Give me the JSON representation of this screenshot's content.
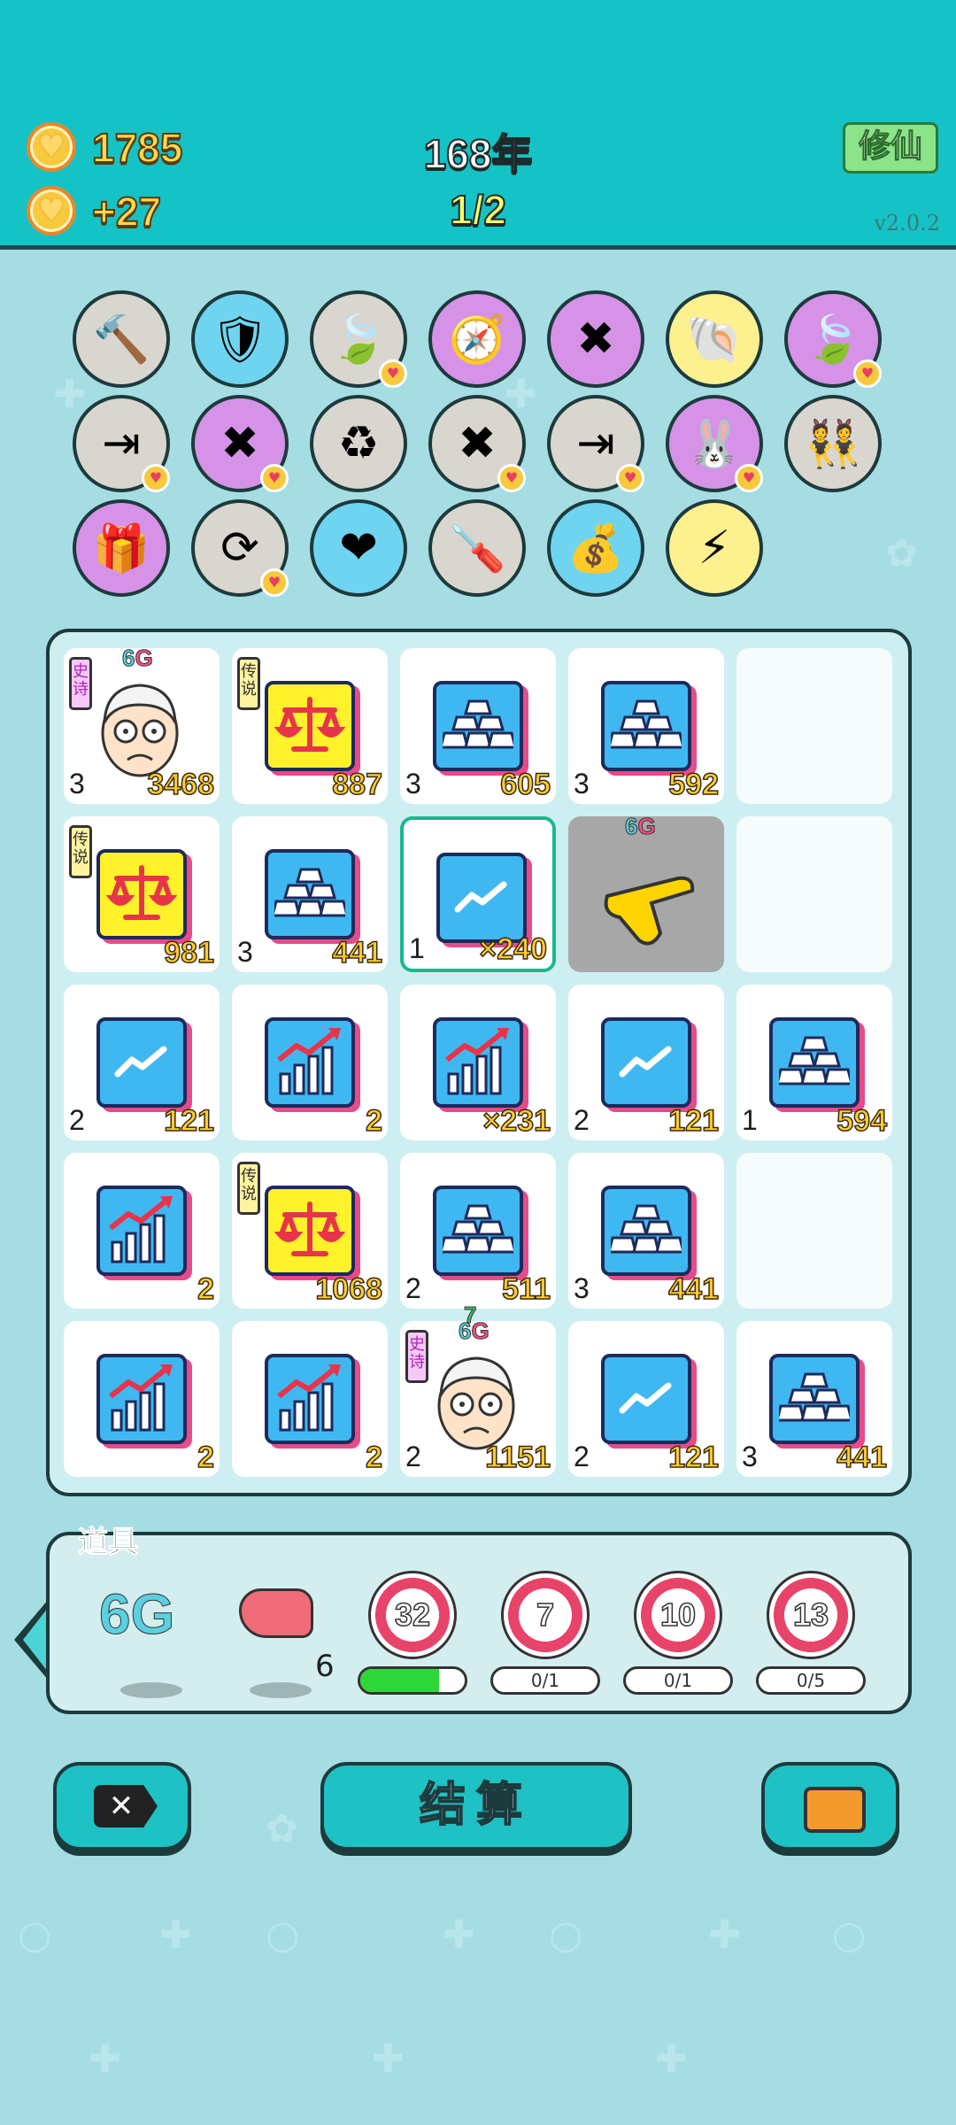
{
  "header": {
    "coins": "1785",
    "income": "+27",
    "year": "168年",
    "progress": "1/2",
    "cultivate_label": "修仙",
    "version": "v2.0.2"
  },
  "skills": [
    {
      "name": "hammer-icon",
      "glyph": "🔨",
      "bg": "gray",
      "badge": false
    },
    {
      "name": "shield-wrench-icon",
      "glyph": "🛡",
      "bg": "blue",
      "badge": false
    },
    {
      "name": "leaf-icon",
      "glyph": "🍃",
      "bg": "gray",
      "badge": true
    },
    {
      "name": "compass-icon",
      "glyph": "🧭",
      "bg": "purple",
      "badge": false
    },
    {
      "name": "multiplier-face-icon",
      "glyph": "✖",
      "bg": "purple",
      "badge": false
    },
    {
      "name": "shell-icon",
      "glyph": "🐚",
      "bg": "yellow",
      "badge": false
    },
    {
      "name": "leaf-icon",
      "glyph": "🍃",
      "bg": "purple",
      "badge": true
    },
    {
      "name": "skip-icon",
      "glyph": "⇥",
      "bg": "gray",
      "badge": true
    },
    {
      "name": "multiplier-face-icon",
      "glyph": "✖",
      "bg": "purple",
      "badge": true
    },
    {
      "name": "recycle-icon",
      "glyph": "♻",
      "bg": "gray",
      "badge": false
    },
    {
      "name": "delete-tag-icon",
      "glyph": "✖",
      "bg": "gray",
      "badge": true
    },
    {
      "name": "skip-icon",
      "glyph": "⇥",
      "bg": "gray",
      "badge": true
    },
    {
      "name": "rabbit-icon",
      "glyph": "🐰",
      "bg": "purple",
      "badge": true
    },
    {
      "name": "twins-icon",
      "glyph": "👯",
      "bg": "gray",
      "badge": false
    },
    {
      "name": "gift-box-icon",
      "glyph": "🎁",
      "bg": "purple",
      "badge": false
    },
    {
      "name": "refresh-icon",
      "glyph": "⟳",
      "bg": "gray",
      "badge": true
    },
    {
      "name": "heart-potion-icon",
      "glyph": "❤",
      "bg": "blue",
      "badge": false
    },
    {
      "name": "screwdriver-icon",
      "glyph": "🪛",
      "bg": "gray",
      "badge": false
    },
    {
      "name": "money-bag-icon",
      "glyph": "💰",
      "bg": "blue",
      "badge": false
    },
    {
      "name": "lightning-icon",
      "glyph": "⚡",
      "bg": "yellow",
      "badge": false
    }
  ],
  "board": [
    {
      "type": "face",
      "tag": "史诗",
      "tagType": "epic",
      "g": "6G",
      "level": "3",
      "value": "3468"
    },
    {
      "type": "scale",
      "tag": "传说",
      "tagType": "legend",
      "level": "",
      "value": "887"
    },
    {
      "type": "gold",
      "level": "3",
      "value": "605"
    },
    {
      "type": "gold",
      "level": "3",
      "value": "592"
    },
    {
      "type": "empty"
    },
    {
      "type": "scale",
      "tag": "传说",
      "tagType": "legend",
      "level": "",
      "value": "981"
    },
    {
      "type": "gold",
      "level": "3",
      "value": "441"
    },
    {
      "type": "trend",
      "level": "1",
      "value": "×240",
      "selected": true
    },
    {
      "type": "hand",
      "g": "6G"
    },
    {
      "type": "empty"
    },
    {
      "type": "trend",
      "level": "2",
      "value": "121"
    },
    {
      "type": "chart",
      "level": "",
      "value": "2"
    },
    {
      "type": "chart",
      "level": "",
      "value": "×231"
    },
    {
      "type": "trend",
      "level": "2",
      "value": "121"
    },
    {
      "type": "gold",
      "level": "1",
      "value": "594"
    },
    {
      "type": "chart",
      "level": "",
      "value": "2"
    },
    {
      "type": "scale",
      "tag": "传说",
      "tagType": "legend",
      "level": "",
      "value": "1068"
    },
    {
      "type": "gold",
      "level": "2",
      "value": "511"
    },
    {
      "type": "gold",
      "level": "3",
      "value": "441"
    },
    {
      "type": "empty"
    },
    {
      "type": "chart",
      "level": "",
      "value": "2"
    },
    {
      "type": "chart",
      "level": "",
      "value": "2"
    },
    {
      "type": "face",
      "tag": "史诗",
      "tagType": "epic",
      "g": "6G",
      "g2": "7",
      "level": "2",
      "value": "1151"
    },
    {
      "type": "trend",
      "level": "2",
      "value": "121"
    },
    {
      "type": "gold",
      "level": "3",
      "value": "441"
    }
  ],
  "items": {
    "title": "道具",
    "g_label": "6G",
    "liver_count": "6",
    "targets": [
      {
        "value": "32",
        "progress_text": "",
        "fill": 0.75
      },
      {
        "value": "7",
        "progress_text": "0/1",
        "fill": 0
      },
      {
        "value": "10",
        "progress_text": "0/1",
        "fill": 0
      },
      {
        "value": "13",
        "progress_text": "0/5",
        "fill": 0
      }
    ]
  },
  "buttons": {
    "settle_label": "结算"
  },
  "colors": {
    "header": "#15c3c6",
    "board": "#cdeff1",
    "value": "#ffcc33",
    "accent_pink": "#e84a8a"
  }
}
